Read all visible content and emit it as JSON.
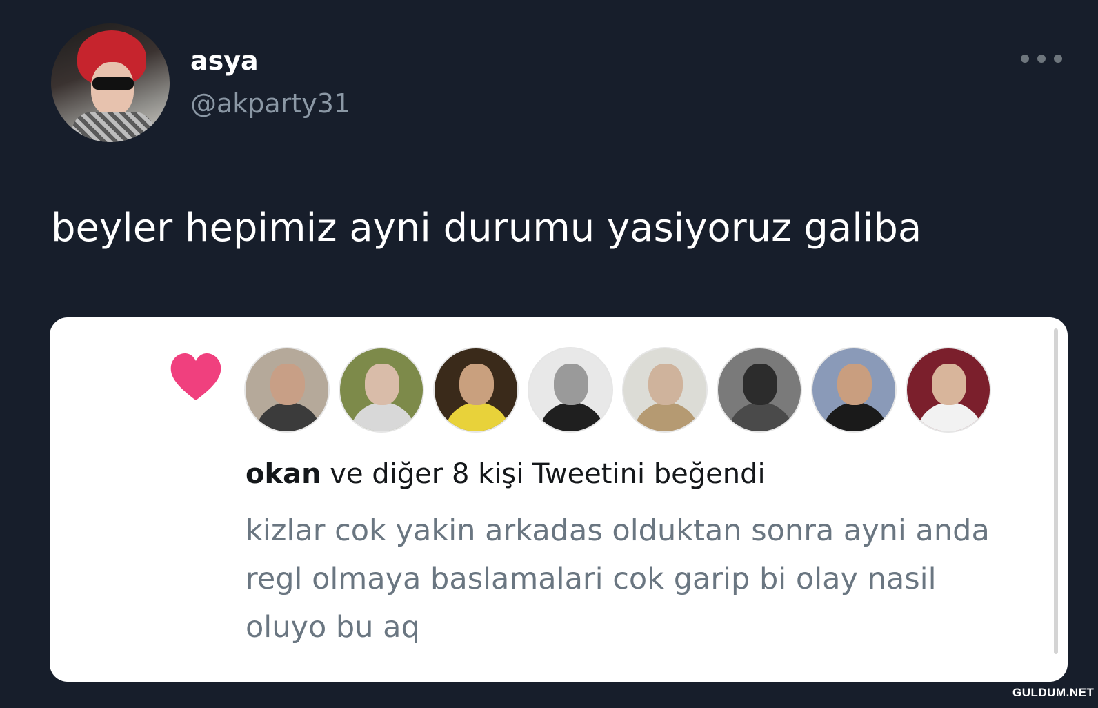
{
  "author": {
    "name": "asya",
    "handle": "@akparty31"
  },
  "tweet": {
    "text": "beyler hepimiz ayni durumu yasiyoruz galiba"
  },
  "embedded_notification": {
    "liked_by_name": "okan",
    "liked_by_rest": " ve diğer 8 kişi Tweetini beğendi",
    "liked_tweet_text": "kizlar cok yakin arkadas olduktan sonra ayni anda regl olmaya baslamalari cok garip bi olay nasil oluyo bu aq",
    "liker_avatars": [
      {
        "bg": "#b5a99a",
        "skin": "#c89f86",
        "cloth": "#3b3b3b"
      },
      {
        "bg": "#7d8a4a",
        "skin": "#d9bca9",
        "cloth": "#d8d8d8"
      },
      {
        "bg": "#3a2a1a",
        "skin": "#c9a07e",
        "cloth": "#e8d23a"
      },
      {
        "bg": "#e8e8e8",
        "skin": "#9a9a9a",
        "cloth": "#1f1f1f"
      },
      {
        "bg": "#dcdcd6",
        "skin": "#cfb39c",
        "cloth": "#b59a72"
      },
      {
        "bg": "#7a7a7a",
        "skin": "#2c2c2c",
        "cloth": "#4a4a4a"
      },
      {
        "bg": "#8a9ab8",
        "skin": "#c99e7f",
        "cloth": "#1a1a1a"
      },
      {
        "bg": "#7b1f2c",
        "skin": "#d8b59b",
        "cloth": "#f2f2f2"
      }
    ]
  },
  "watermark": "GULDUM.NET",
  "colors": {
    "background": "#171e2b",
    "heart": "#f0407e",
    "name_text": "#ffffff",
    "handle_text": "#8b98a5",
    "liked_text": "#6a7681"
  }
}
